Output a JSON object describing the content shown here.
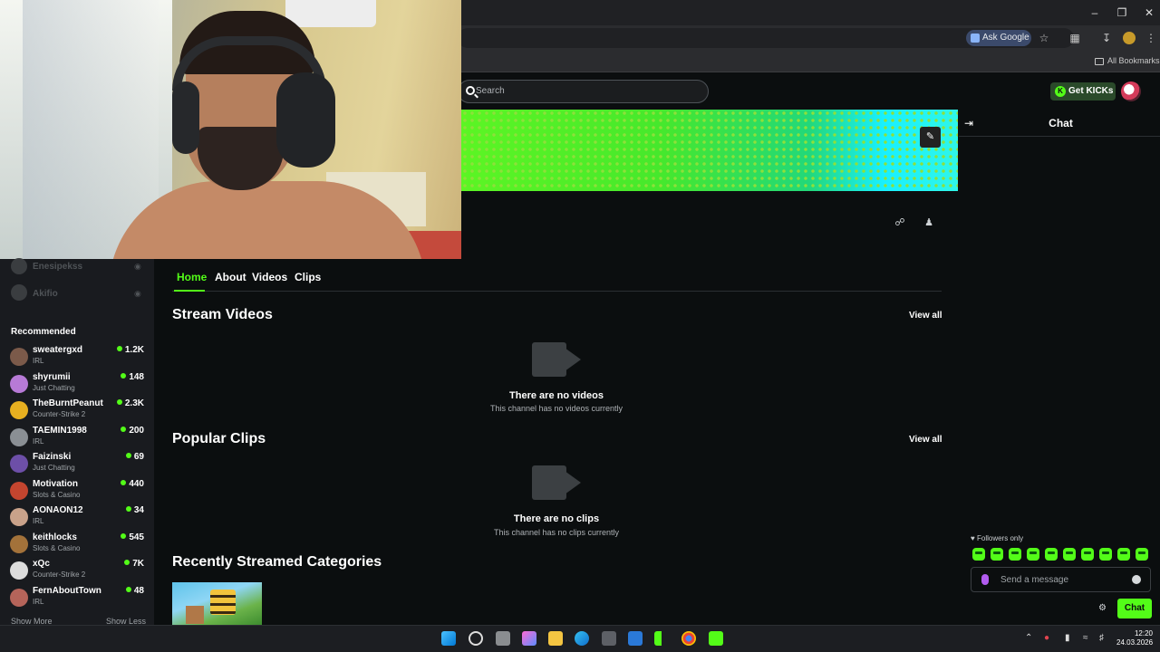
{
  "browser": {
    "ask_google": "Ask Google",
    "all_bookmarks": "All Bookmarks",
    "window_controls": [
      "minimize-icon",
      "restore-icon",
      "close-icon"
    ]
  },
  "header": {
    "search_placeholder": "Search",
    "get_kicks": "Get KICKs"
  },
  "sidebar": {
    "following_faded": [
      {
        "name": "Enesipekss"
      },
      {
        "name": "Akifio"
      }
    ],
    "recommended_title": "Recommended",
    "recommended": [
      {
        "name": "sweatergxd",
        "category": "IRL",
        "viewers": "1.2K",
        "color": "#7b5a4a"
      },
      {
        "name": "shyrumii",
        "category": "Just Chatting",
        "viewers": "148",
        "color": "#b77ad6"
      },
      {
        "name": "TheBurntPeanut",
        "category": "Counter-Strike 2",
        "viewers": "2.3K",
        "color": "#e8b020"
      },
      {
        "name": "TAEMIN1998",
        "category": "IRL",
        "viewers": "200",
        "color": "#8a8f94"
      },
      {
        "name": "Faizinski",
        "category": "Just Chatting",
        "viewers": "69",
        "color": "#6d4fa8"
      },
      {
        "name": "Motivation",
        "category": "Slots & Casino",
        "viewers": "440",
        "color": "#c4452f"
      },
      {
        "name": "AONAON12",
        "category": "IRL",
        "viewers": "34",
        "color": "#c9a28a"
      },
      {
        "name": "keithlocks",
        "category": "Slots & Casino",
        "viewers": "545",
        "color": "#a3723a"
      },
      {
        "name": "xQc",
        "category": "Counter-Strike 2",
        "viewers": "7K",
        "color": "#dcdcdc"
      },
      {
        "name": "FernAboutTown",
        "category": "IRL",
        "viewers": "48",
        "color": "#b5645a"
      }
    ],
    "show_more": "Show More",
    "show_less": "Show Less"
  },
  "tabs": [
    "Home",
    "About",
    "Videos",
    "Clips"
  ],
  "sections": {
    "stream_videos": {
      "title": "Stream Videos",
      "view_all": "View all",
      "empty_title": "There are no videos",
      "empty_sub": "This channel has no videos currently"
    },
    "popular_clips": {
      "title": "Popular Clips",
      "view_all": "View all",
      "empty_title": "There are no clips",
      "empty_sub": "This channel has no clips currently"
    },
    "recent_categories": {
      "title": "Recently Streamed Categories"
    }
  },
  "chat": {
    "title": "Chat",
    "followers_only": "Followers only",
    "placeholder": "Send a message",
    "send_label": "Chat"
  },
  "taskbar": {
    "time": "12:20",
    "date": "24.03.2026"
  },
  "colors": {
    "accent": "#53fc18",
    "background": "#0b0e0f",
    "sidebar": "#191b1f"
  }
}
